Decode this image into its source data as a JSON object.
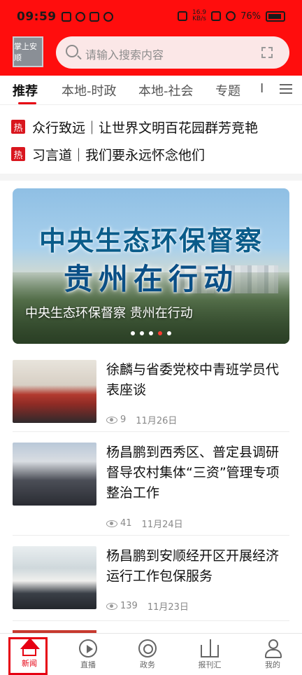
{
  "status_bar": {
    "time": "09:59",
    "battery": "76%",
    "net_speed_top": "16.9",
    "net_speed_bottom": "KB/s"
  },
  "header": {
    "logo_text": "掌上安顺",
    "search_placeholder": "请输入搜索内容"
  },
  "tabs": [
    {
      "label": "推荐",
      "active": true
    },
    {
      "label": "本地-时政",
      "active": false
    },
    {
      "label": "本地-社会",
      "active": false
    },
    {
      "label": "专题",
      "active": false
    },
    {
      "label": "I",
      "active": false
    }
  ],
  "hot_list": [
    {
      "badge": "热",
      "text": "众行致远｜让世界文明百花园群芳竞艳"
    },
    {
      "badge": "热",
      "text": "习言道｜我们要永远怀念他们"
    }
  ],
  "banner": {
    "title_line1": "中央生态环保督察",
    "title_line2": "贵州在行动",
    "caption": "中央生态环保督察 贵州在行动",
    "slide_count": 5,
    "active_slide": 4
  },
  "news": [
    {
      "headline": "徐麟与省委党校中青班学员代表座谈",
      "views": "9",
      "date": "11月26日"
    },
    {
      "headline": "杨昌鹏到西秀区、普定县调研督导农村集体“三资”管理专项整治工作",
      "views": "41",
      "date": "11月24日"
    },
    {
      "headline": "杨昌鹏到安顺经开区开展经济运行工作包保服务",
      "views": "139",
      "date": "11月23日"
    }
  ],
  "bottom_nav": [
    {
      "label": "新闻",
      "icon": "home-icon",
      "active": true
    },
    {
      "label": "直播",
      "icon": "play-icon",
      "active": false
    },
    {
      "label": "政务",
      "icon": "browser-icon",
      "active": false
    },
    {
      "label": "报刊汇",
      "icon": "book-icon",
      "active": false
    },
    {
      "label": "我的",
      "icon": "user-icon",
      "active": false
    }
  ],
  "colors": {
    "brand_red": "#ff0d0d",
    "accent_red": "#e60012",
    "hot_badge": "#d9161e"
  }
}
